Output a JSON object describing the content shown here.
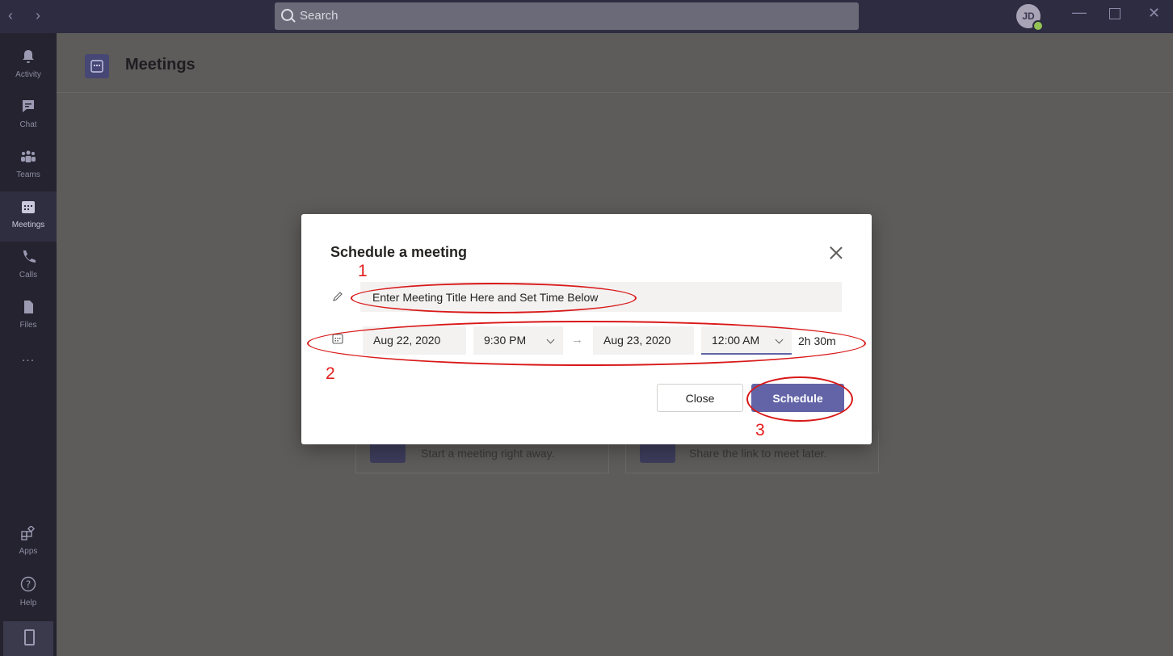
{
  "titlebar": {
    "search_placeholder": "Search",
    "avatar_initials": "JD",
    "icons": {
      "back": "chevron-left-icon",
      "forward": "chevron-right-icon",
      "minimize": "minimize-icon",
      "maximize": "maximize-icon",
      "close": "close-icon"
    }
  },
  "sidebar": {
    "items": [
      {
        "label": "Activity",
        "icon": "bell-icon"
      },
      {
        "label": "Chat",
        "icon": "chat-icon"
      },
      {
        "label": "Teams",
        "icon": "teams-icon"
      },
      {
        "label": "Meetings",
        "icon": "calendar-icon",
        "active": true
      },
      {
        "label": "Calls",
        "icon": "phone-icon"
      },
      {
        "label": "Files",
        "icon": "file-icon"
      },
      {
        "label": "...",
        "icon": "more-icon"
      }
    ],
    "bottom_items": [
      {
        "label": "Apps",
        "icon": "apps-icon"
      },
      {
        "label": "Help",
        "icon": "help-icon"
      }
    ]
  },
  "header": {
    "title": "Meetings"
  },
  "cards": [
    {
      "text": "Start a meeting right away."
    },
    {
      "text": "Share the link to meet later."
    }
  ],
  "dialog": {
    "title": "Schedule a meeting",
    "title_input_value": "Enter Meeting Title Here and Set Time Below",
    "start_date": "Aug 22, 2020",
    "start_time": "9:30 PM",
    "end_date": "Aug 23, 2020",
    "end_time": "12:00 AM",
    "duration": "2h 30m",
    "close_label": "Close",
    "schedule_label": "Schedule"
  },
  "annotations": [
    "1",
    "2",
    "3"
  ],
  "colors": {
    "accent": "#6264a7",
    "annotation": "#e41b1b",
    "titlebar": "#2d2c40",
    "sidebar": "#24232f"
  }
}
